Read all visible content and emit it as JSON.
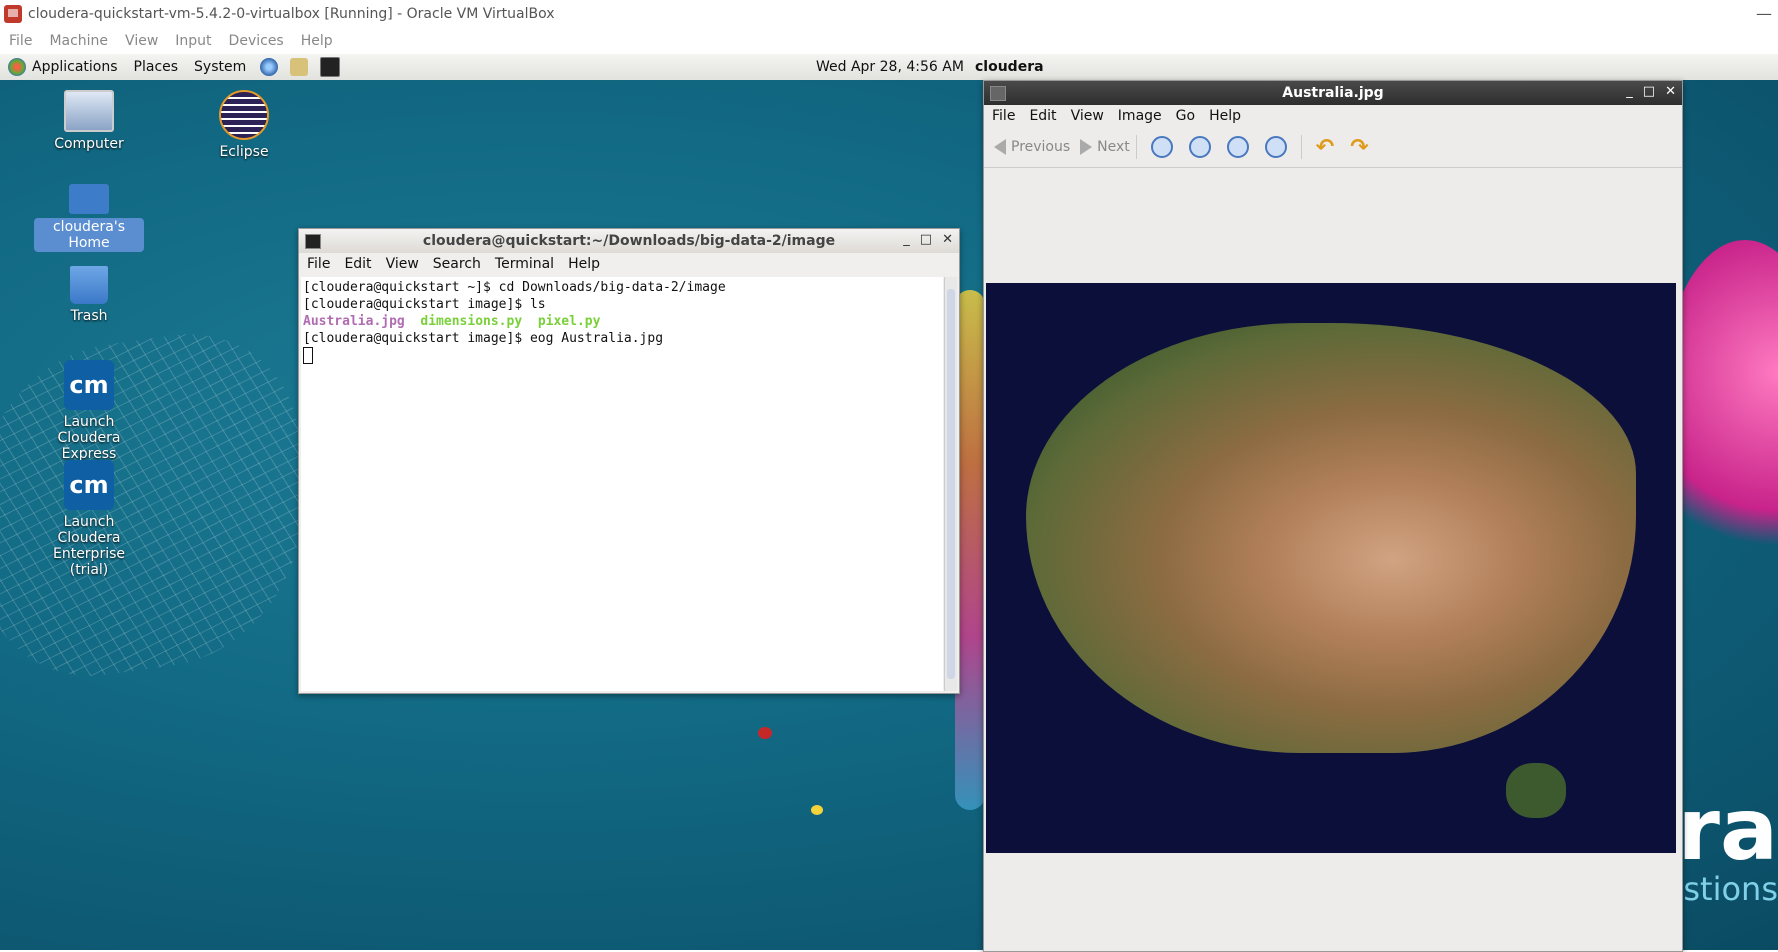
{
  "vbox": {
    "title": "cloudera-quickstart-vm-5.4.2-0-virtualbox [Running] - Oracle VM VirtualBox",
    "menu": [
      "File",
      "Machine",
      "View",
      "Input",
      "Devices",
      "Help"
    ],
    "minimize": "—"
  },
  "panel": {
    "applications": "Applications",
    "places": "Places",
    "system": "System",
    "clock": "Wed Apr 28,  4:56 AM",
    "user": "cloudera"
  },
  "desktop_icons": {
    "computer": "Computer",
    "eclipse": "Eclipse",
    "home": "cloudera's Home",
    "trash": "Trash",
    "cm_express": "Launch Cloudera Express",
    "cm_enterprise": "Launch Cloudera Enterprise (trial)",
    "cm_glyph": "cm"
  },
  "brand": {
    "big": "ra",
    "small": "stions"
  },
  "terminal": {
    "title": "cloudera@quickstart:~/Downloads/big-data-2/image",
    "menu": [
      "File",
      "Edit",
      "View",
      "Search",
      "Terminal",
      "Help"
    ],
    "lines": [
      "[cloudera@quickstart ~]$ cd Downloads/big-data-2/image",
      "[cloudera@quickstart image]$ ls"
    ],
    "ls_files": [
      "Australia.jpg",
      "dimensions.py",
      "pixel.py"
    ],
    "last_line": "[cloudera@quickstart image]$ eog Australia.jpg"
  },
  "eog": {
    "title": "Australia.jpg",
    "menu": [
      "File",
      "Edit",
      "View",
      "Image",
      "Go",
      "Help"
    ],
    "previous": "Previous",
    "next": "Next"
  },
  "colors": {
    "desktop": "#126a84",
    "selection": "#5a8ed1",
    "ls_purple": "#b06cb0",
    "ls_green": "#7ad03a"
  }
}
